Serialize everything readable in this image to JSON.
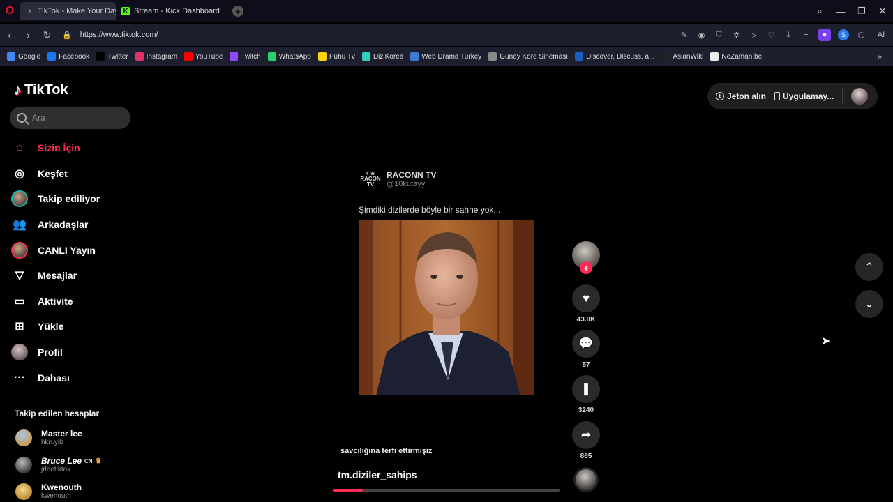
{
  "browser": {
    "tabs": [
      {
        "title": "TikTok - Make Your Day",
        "active": true,
        "icon": "tiktok-icon"
      },
      {
        "title": "Stream - Kick Dashboard",
        "active": false,
        "icon": "kick-icon"
      }
    ],
    "url": "https://www.tiktok.com/",
    "bookmarks": [
      {
        "label": "Google",
        "icon": "google-icon",
        "color": "#4285f4"
      },
      {
        "label": "Facebook",
        "icon": "facebook-icon",
        "color": "#1877f2"
      },
      {
        "label": "Twitter",
        "icon": "x-icon",
        "color": "#000000"
      },
      {
        "label": "Instagram",
        "icon": "instagram-icon",
        "color": "#e1306c"
      },
      {
        "label": "YouTube",
        "icon": "youtube-icon",
        "color": "#ff0000"
      },
      {
        "label": "Twitch",
        "icon": "twitch-icon",
        "color": "#9146ff"
      },
      {
        "label": "WhatsApp",
        "icon": "whatsapp-icon",
        "color": "#25d366"
      },
      {
        "label": "Puhu Tv",
        "icon": "puhu-icon",
        "color": "#ffd400"
      },
      {
        "label": "DiziKorea",
        "icon": "dizikorea-icon",
        "color": "#2ad0c0"
      },
      {
        "label": "Web Drama Turkey",
        "icon": "webdrama-icon",
        "color": "#3a7bd5"
      },
      {
        "label": "Güney Kore Sineması",
        "icon": "film-icon",
        "color": "#888888"
      },
      {
        "label": "Discover, Discuss, a...",
        "icon": "mdl-icon",
        "color": "#1d5fbf"
      },
      {
        "label": "AsianWiki",
        "icon": "asianwiki-icon",
        "color": "#222222"
      },
      {
        "label": "NeZaman.be",
        "icon": "nezaman-icon",
        "color": "#eeeeee"
      }
    ]
  },
  "sidebar": {
    "logo": "TikTok",
    "search_placeholder": "Ara",
    "nav": [
      {
        "label": "Sizin İçin",
        "icon": "home-icon",
        "active": true
      },
      {
        "label": "Keşfet",
        "icon": "compass-icon",
        "active": false
      },
      {
        "label": "Takip ediliyor",
        "icon": "following-avatar",
        "active": false
      },
      {
        "label": "Arkadaşlar",
        "icon": "friends-icon",
        "active": false
      },
      {
        "label": "CANLI Yayın",
        "icon": "live-avatar",
        "active": false
      },
      {
        "label": "Mesajlar",
        "icon": "send-icon",
        "active": false
      },
      {
        "label": "Aktivite",
        "icon": "activity-icon",
        "active": false
      },
      {
        "label": "Yükle",
        "icon": "upload-icon",
        "active": false
      },
      {
        "label": "Profil",
        "icon": "profile-avatar",
        "active": false
      },
      {
        "label": "Dahası",
        "icon": "more-icon",
        "active": false
      }
    ],
    "following_title": "Takip edilen hesaplar",
    "accounts": [
      {
        "name": "Master lee",
        "handle": "hkn.yib"
      },
      {
        "name": "Bruce Lee",
        "badge": "CN",
        "handle": "jrleetiktok"
      },
      {
        "name": "Kwenouth",
        "handle": "kwenouth"
      }
    ]
  },
  "header": {
    "coins_label": "Jeton alın",
    "app_label": "Uygulamay..."
  },
  "post": {
    "author_name": "RACONN TV",
    "author_handle": "@10kutayy",
    "logo_text_top": "RACON",
    "logo_text_bottom": "TV",
    "caption": "Şimdiki dizilerde böyle bir sahne yok...",
    "overlay_text": "savcılığına terfi ettirmişiz",
    "video_author": "tm.diziler_sahips",
    "progress": 0.13,
    "likes": "43.9K",
    "comments": "57",
    "saves": "3240",
    "shares": "865"
  }
}
